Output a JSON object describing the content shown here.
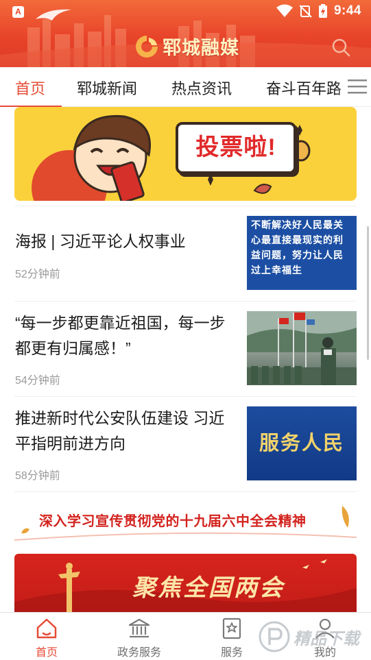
{
  "status_bar": {
    "time": "9:44",
    "app_indicator": "A"
  },
  "header": {
    "app_title": "郓城融媒"
  },
  "tabs": [
    {
      "label": "首页"
    },
    {
      "label": "郓城新闻"
    },
    {
      "label": "热点资讯"
    },
    {
      "label": "奋斗百年路"
    }
  ],
  "banner_vote": {
    "text": "投票啦!"
  },
  "news": [
    {
      "title": "海报 | 习近平论人权事业",
      "time": "52分钟前",
      "thumb_text": "不断解决好人民最关心最直接最现实的利益问题，努力让人民过上幸福生"
    },
    {
      "title": "“每一步都更靠近祖国，每一步都更有归属感！”",
      "time": "54分钟前"
    },
    {
      "title": "推进新时代公安队伍建设 习近平指明前进方向",
      "time": "58分钟前",
      "thumb_text": "服务人民"
    }
  ],
  "slogan": {
    "text": "深入学习宣传贯彻党的十九届六中全会精神"
  },
  "bottom_banner": {
    "text": "聚焦全国两会"
  },
  "bottom_nav": [
    {
      "label": "首页",
      "icon": "home-icon"
    },
    {
      "label": "政务服务",
      "icon": "government-icon"
    },
    {
      "label": "服务",
      "icon": "service-icon"
    },
    {
      "label": "我的",
      "icon": "profile-icon"
    }
  ],
  "watermark": {
    "text": "精品下载"
  },
  "colors": {
    "accent": "#e64a36",
    "header": "#e8442a",
    "vote_banner": "#fbd13b",
    "news_blue": "#1c4fa3"
  }
}
